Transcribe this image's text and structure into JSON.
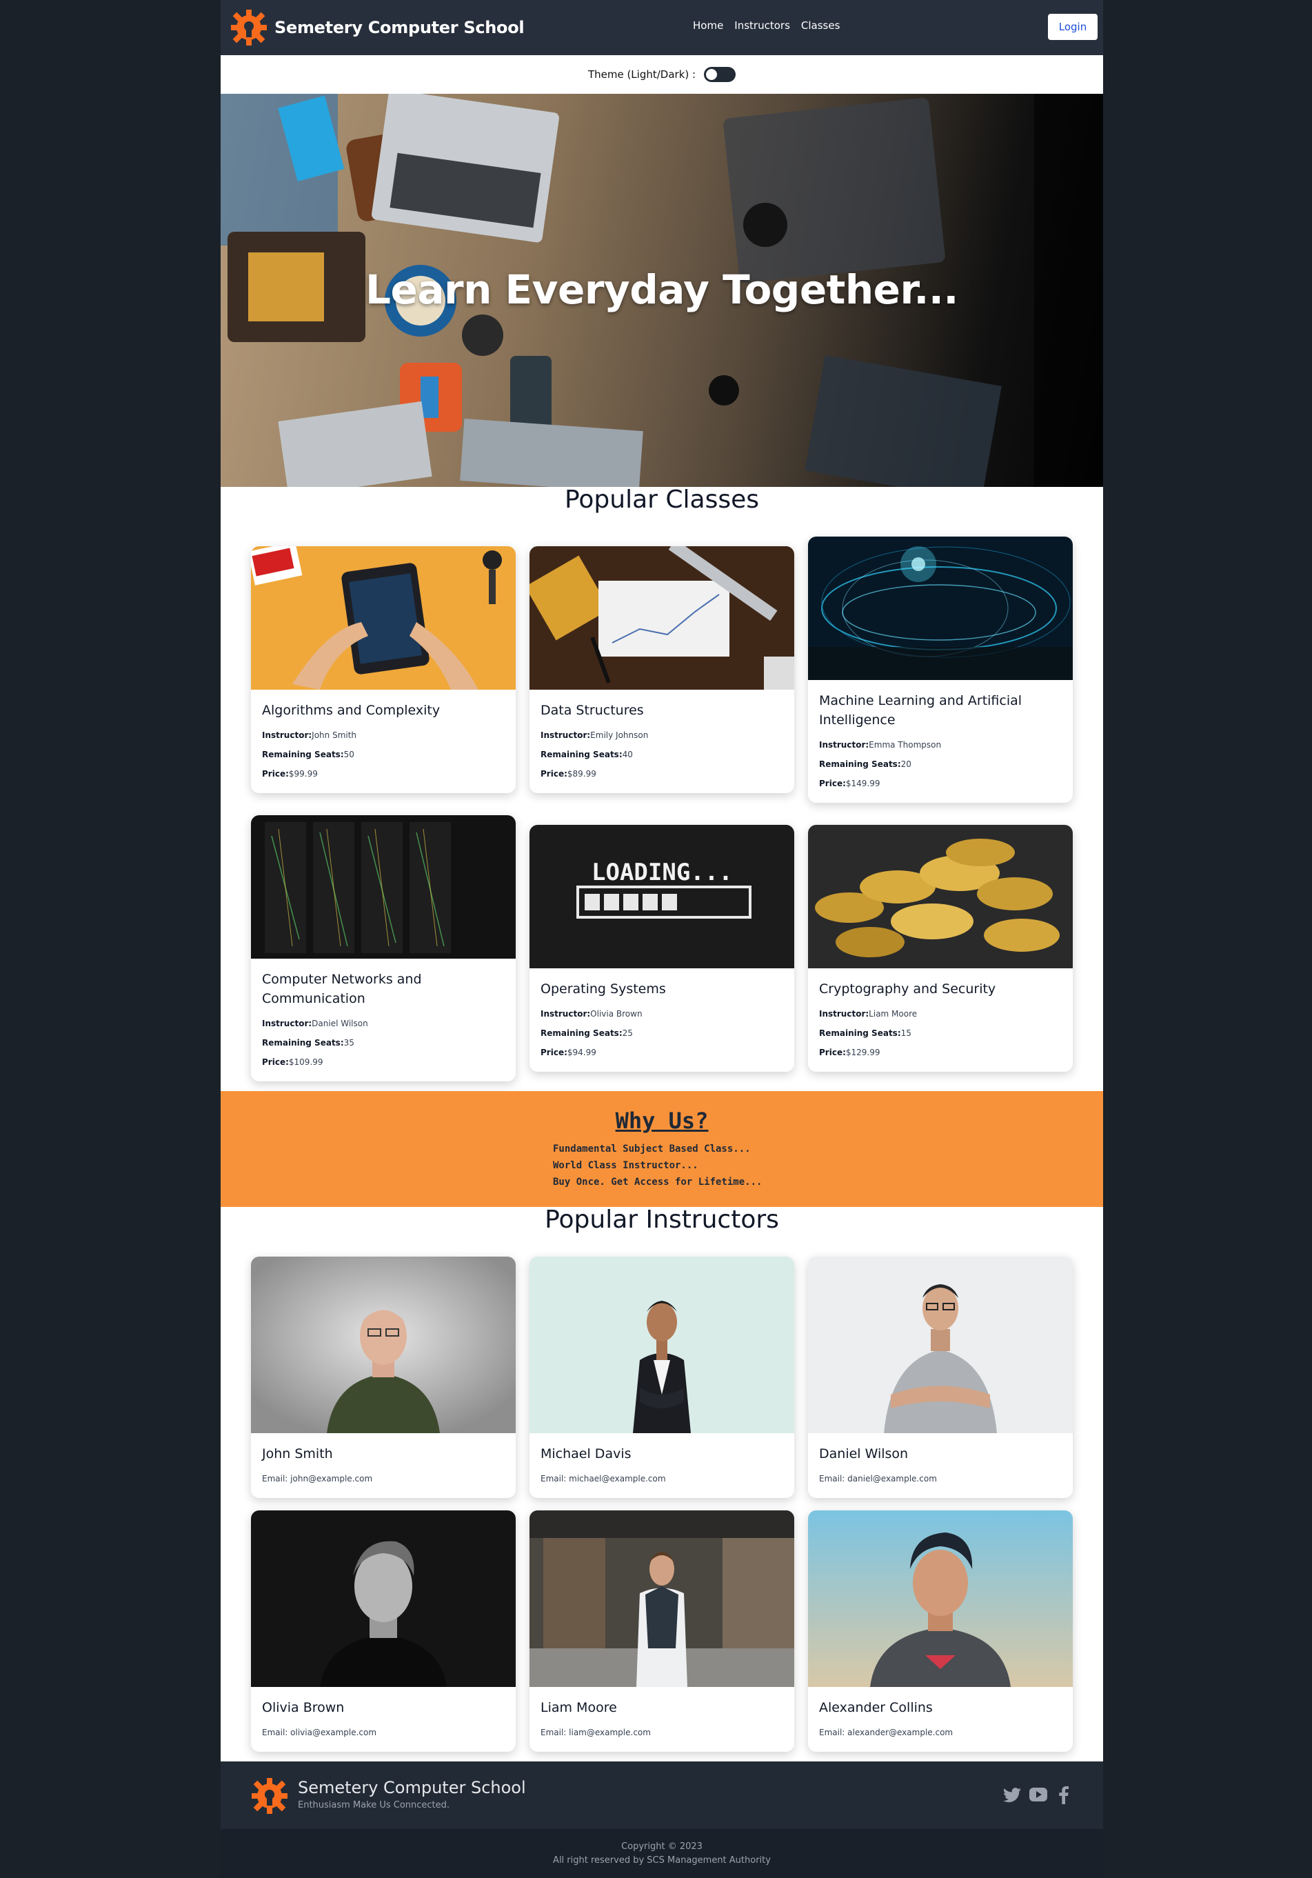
{
  "brand": {
    "name": "Semetery Computer School",
    "accent": "#f86b1c"
  },
  "nav": {
    "links": [
      "Home",
      "Instructors",
      "Classes"
    ],
    "login_label": "Login"
  },
  "theme": {
    "label": "Theme (Light/Dark) :"
  },
  "hero": {
    "title": "Learn Everyday Together..."
  },
  "popular_classes": {
    "title": "Popular Classes",
    "labels": {
      "instructor": "Instructor:",
      "seats": "Remaining Seats:",
      "price": "Price:"
    },
    "items": [
      {
        "title": "Algorithms and Complexity",
        "instructor": "John Smith",
        "seats": "50",
        "price": "$99.99"
      },
      {
        "title": "Data Structures",
        "instructor": "Emily Johnson",
        "seats": "40",
        "price": "$89.99"
      },
      {
        "title": "Machine Learning and Artificial Intelligence",
        "instructor": "Emma Thompson",
        "seats": "20",
        "price": "$149.99"
      },
      {
        "title": "Computer Networks and Communication",
        "instructor": "Daniel Wilson",
        "seats": "35",
        "price": "$109.99"
      },
      {
        "title": "Operating Systems",
        "instructor": "Olivia Brown",
        "seats": "25",
        "price": "$94.99"
      },
      {
        "title": "Cryptography and Security",
        "instructor": "Liam Moore",
        "seats": "15",
        "price": "$129.99"
      }
    ]
  },
  "why_us": {
    "title": "Why Us?",
    "points": [
      "Fundamental Subject Based Class...",
      "World Class Instructor...",
      "Buy Once. Get Access for Lifetime..."
    ],
    "bg_color": "#f8923a"
  },
  "popular_instructors": {
    "title": "Popular Instructors",
    "email_label": "Email: ",
    "items": [
      {
        "name": "John Smith",
        "email": "john@example.com"
      },
      {
        "name": "Michael Davis",
        "email": "michael@example.com"
      },
      {
        "name": "Daniel Wilson",
        "email": "daniel@example.com"
      },
      {
        "name": "Olivia Brown",
        "email": "olivia@example.com"
      },
      {
        "name": "Liam Moore",
        "email": "liam@example.com"
      },
      {
        "name": "Alexander Collins",
        "email": "alexander@example.com"
      }
    ]
  },
  "footer": {
    "name": "Semetery Computer School",
    "tagline": "Enthusiasm Make Us Conncected.",
    "social": [
      "twitter-icon",
      "youtube-icon",
      "facebook-icon"
    ],
    "copyright": "Copyright © 2023",
    "rights": "All right reserved by SCS Management Authority"
  }
}
